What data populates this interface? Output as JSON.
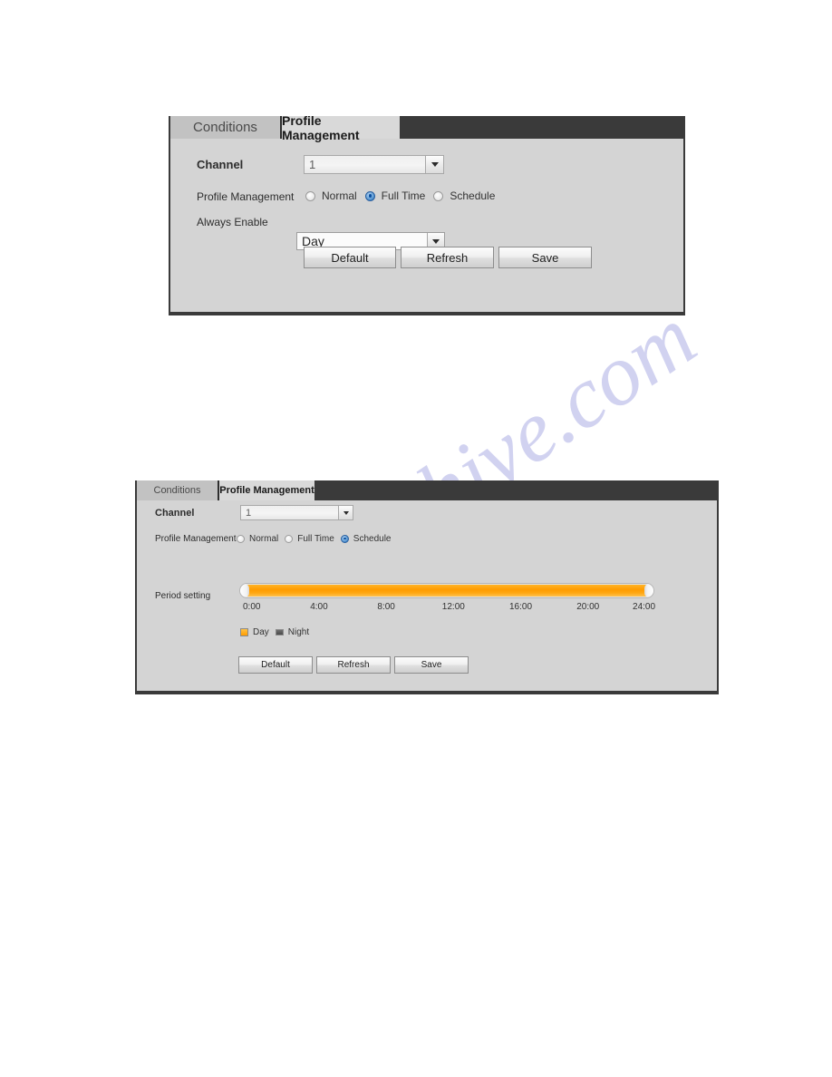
{
  "watermark": {
    "text": "manualshive.com"
  },
  "panels": [
    {
      "id": "figure-full-time",
      "tabs": [
        {
          "label": "Conditions",
          "active": false
        },
        {
          "label": "Profile Management",
          "active": true
        }
      ],
      "fields": {
        "channel_label": "Channel",
        "channel_value": "1",
        "profile_label": "Profile Management",
        "always_enable_label": "Always Enable",
        "always_enable_value": "Day"
      },
      "radios": [
        {
          "label": "Normal",
          "selected": false
        },
        {
          "label": "Full Time",
          "selected": true
        },
        {
          "label": "Schedule",
          "selected": false
        }
      ],
      "buttons": [
        {
          "label": "Default"
        },
        {
          "label": "Refresh"
        },
        {
          "label": "Save"
        }
      ]
    },
    {
      "id": "figure-schedule",
      "tabs": [
        {
          "label": "Conditions",
          "active": false
        },
        {
          "label": "Profile Management",
          "active": true
        }
      ],
      "fields": {
        "channel_label": "Channel",
        "channel_value": "1",
        "profile_label": "Profile Management",
        "period_label": "Period setting"
      },
      "radios": [
        {
          "label": "Normal",
          "selected": false
        },
        {
          "label": "Full Time",
          "selected": false
        },
        {
          "label": "Schedule",
          "selected": true
        }
      ],
      "timeline": {
        "ticks": [
          "0:00",
          "4:00",
          "8:00",
          "12:00",
          "16:00",
          "20:00",
          "24:00"
        ],
        "fill_color": "#ff9c00",
        "range_start": "0:00",
        "range_end": "24:00",
        "legend": [
          {
            "label": "Day",
            "color": "#ff9c00"
          },
          {
            "label": "Night",
            "color": "#4a4a4a"
          }
        ]
      },
      "buttons": [
        {
          "label": "Default"
        },
        {
          "label": "Refresh"
        },
        {
          "label": "Save"
        }
      ]
    }
  ]
}
